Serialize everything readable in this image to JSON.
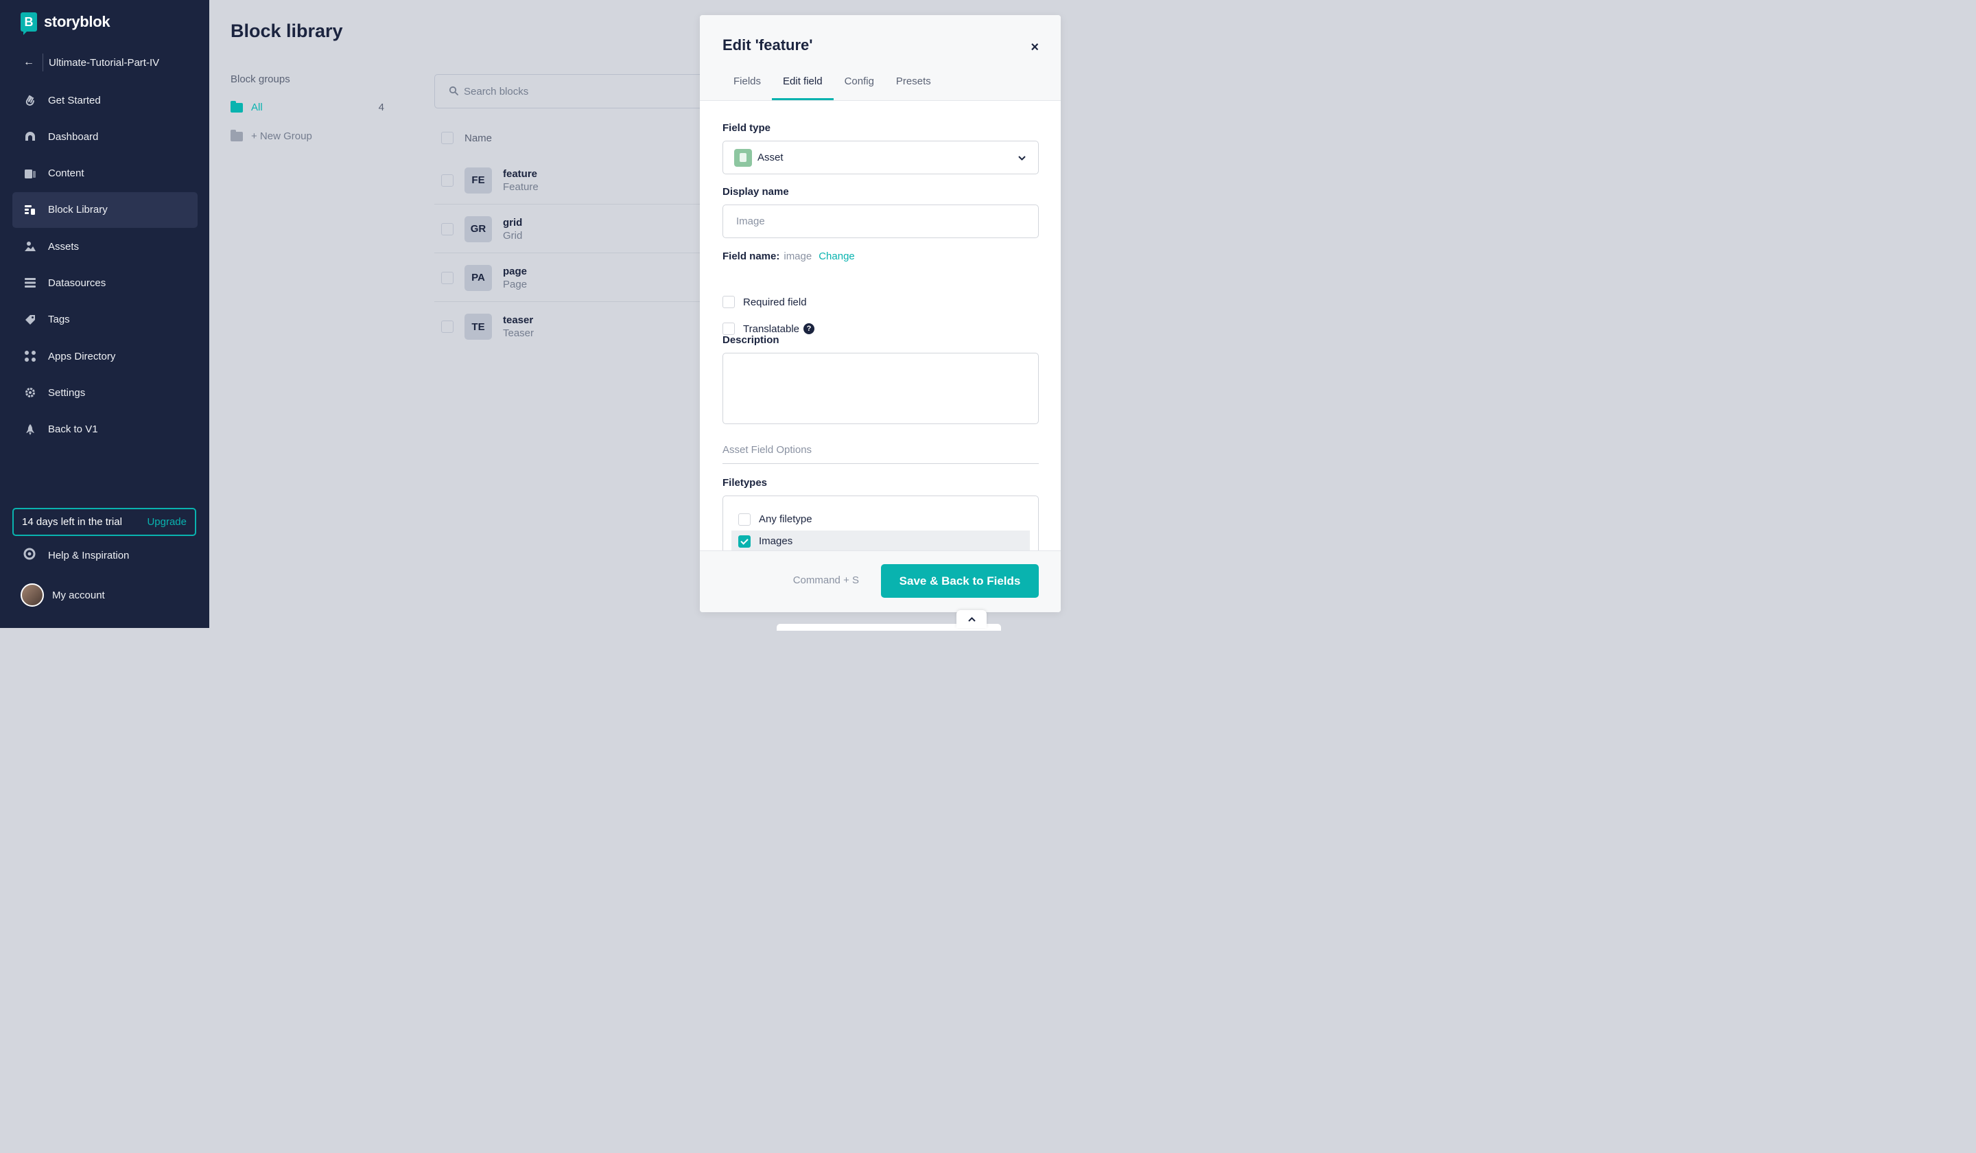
{
  "brand": {
    "name": "storyblok",
    "mark": "B"
  },
  "sidebar": {
    "space_name": "Ultimate-Tutorial-Part-IV",
    "items": [
      {
        "label": "Get Started",
        "icon": "hand-wave-icon"
      },
      {
        "label": "Dashboard",
        "icon": "dashboard-icon"
      },
      {
        "label": "Content",
        "icon": "content-icon"
      },
      {
        "label": "Block Library",
        "icon": "block-library-icon",
        "active": true
      },
      {
        "label": "Assets",
        "icon": "assets-icon"
      },
      {
        "label": "Datasources",
        "icon": "datasources-icon"
      },
      {
        "label": "Tags",
        "icon": "tag-icon"
      },
      {
        "label": "Apps Directory",
        "icon": "apps-icon"
      },
      {
        "label": "Settings",
        "icon": "gear-icon"
      },
      {
        "label": "Back to V1",
        "icon": "rocket-icon"
      }
    ],
    "trial_text": "14 days left in the trial",
    "upgrade_label": "Upgrade",
    "help_label": "Help & Inspiration",
    "account_label": "My account"
  },
  "main": {
    "title": "Block library",
    "groups_label": "Block groups",
    "group_all_label": "All",
    "group_all_count": "4",
    "new_group_label": "+ New Group",
    "search_placeholder": "Search blocks",
    "column_name": "Name",
    "blocks": [
      {
        "badge": "FE",
        "name": "feature",
        "display": "Feature"
      },
      {
        "badge": "GR",
        "name": "grid",
        "display": "Grid"
      },
      {
        "badge": "PA",
        "name": "page",
        "display": "Page"
      },
      {
        "badge": "TE",
        "name": "teaser",
        "display": "Teaser"
      }
    ]
  },
  "panel": {
    "title": "Edit 'feature'",
    "close": "×",
    "tabs": [
      "Fields",
      "Edit field",
      "Config",
      "Presets"
    ],
    "active_tab": "Edit field",
    "field_type_label": "Field type",
    "field_type_value": "Asset",
    "display_name_label": "Display name",
    "display_name_placeholder": "Image",
    "field_name_label": "Field name:",
    "field_name_value": "image",
    "change_label": "Change",
    "required_label": "Required field",
    "translatable_label": "Translatable",
    "description_label": "Description",
    "section_label": "Asset Field Options",
    "filetypes_label": "Filetypes",
    "filetypes": [
      {
        "label": "Any filetype",
        "checked": false
      },
      {
        "label": "Images",
        "checked": true
      }
    ],
    "shortcut": "Command + S",
    "save_label": "Save & Back to Fields"
  },
  "colors": {
    "accent": "#09b3af",
    "sidebar": "#1b243f",
    "background": "#d3d6dd"
  }
}
